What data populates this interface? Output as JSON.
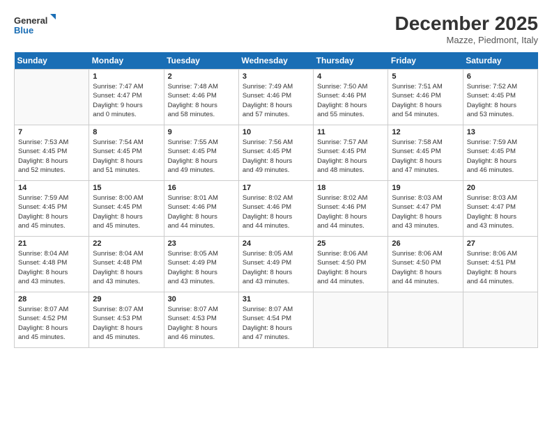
{
  "logo": {
    "line1": "General",
    "line2": "Blue"
  },
  "header": {
    "month": "December 2025",
    "location": "Mazze, Piedmont, Italy"
  },
  "days_of_week": [
    "Sunday",
    "Monday",
    "Tuesday",
    "Wednesday",
    "Thursday",
    "Friday",
    "Saturday"
  ],
  "weeks": [
    [
      {
        "day": "",
        "info": ""
      },
      {
        "day": "1",
        "info": "Sunrise: 7:47 AM\nSunset: 4:47 PM\nDaylight: 9 hours\nand 0 minutes."
      },
      {
        "day": "2",
        "info": "Sunrise: 7:48 AM\nSunset: 4:46 PM\nDaylight: 8 hours\nand 58 minutes."
      },
      {
        "day": "3",
        "info": "Sunrise: 7:49 AM\nSunset: 4:46 PM\nDaylight: 8 hours\nand 57 minutes."
      },
      {
        "day": "4",
        "info": "Sunrise: 7:50 AM\nSunset: 4:46 PM\nDaylight: 8 hours\nand 55 minutes."
      },
      {
        "day": "5",
        "info": "Sunrise: 7:51 AM\nSunset: 4:46 PM\nDaylight: 8 hours\nand 54 minutes."
      },
      {
        "day": "6",
        "info": "Sunrise: 7:52 AM\nSunset: 4:45 PM\nDaylight: 8 hours\nand 53 minutes."
      }
    ],
    [
      {
        "day": "7",
        "info": "Sunrise: 7:53 AM\nSunset: 4:45 PM\nDaylight: 8 hours\nand 52 minutes."
      },
      {
        "day": "8",
        "info": "Sunrise: 7:54 AM\nSunset: 4:45 PM\nDaylight: 8 hours\nand 51 minutes."
      },
      {
        "day": "9",
        "info": "Sunrise: 7:55 AM\nSunset: 4:45 PM\nDaylight: 8 hours\nand 49 minutes."
      },
      {
        "day": "10",
        "info": "Sunrise: 7:56 AM\nSunset: 4:45 PM\nDaylight: 8 hours\nand 49 minutes."
      },
      {
        "day": "11",
        "info": "Sunrise: 7:57 AM\nSunset: 4:45 PM\nDaylight: 8 hours\nand 48 minutes."
      },
      {
        "day": "12",
        "info": "Sunrise: 7:58 AM\nSunset: 4:45 PM\nDaylight: 8 hours\nand 47 minutes."
      },
      {
        "day": "13",
        "info": "Sunrise: 7:59 AM\nSunset: 4:45 PM\nDaylight: 8 hours\nand 46 minutes."
      }
    ],
    [
      {
        "day": "14",
        "info": "Sunrise: 7:59 AM\nSunset: 4:45 PM\nDaylight: 8 hours\nand 45 minutes."
      },
      {
        "day": "15",
        "info": "Sunrise: 8:00 AM\nSunset: 4:45 PM\nDaylight: 8 hours\nand 45 minutes."
      },
      {
        "day": "16",
        "info": "Sunrise: 8:01 AM\nSunset: 4:46 PM\nDaylight: 8 hours\nand 44 minutes."
      },
      {
        "day": "17",
        "info": "Sunrise: 8:02 AM\nSunset: 4:46 PM\nDaylight: 8 hours\nand 44 minutes."
      },
      {
        "day": "18",
        "info": "Sunrise: 8:02 AM\nSunset: 4:46 PM\nDaylight: 8 hours\nand 44 minutes."
      },
      {
        "day": "19",
        "info": "Sunrise: 8:03 AM\nSunset: 4:47 PM\nDaylight: 8 hours\nand 43 minutes."
      },
      {
        "day": "20",
        "info": "Sunrise: 8:03 AM\nSunset: 4:47 PM\nDaylight: 8 hours\nand 43 minutes."
      }
    ],
    [
      {
        "day": "21",
        "info": "Sunrise: 8:04 AM\nSunset: 4:48 PM\nDaylight: 8 hours\nand 43 minutes."
      },
      {
        "day": "22",
        "info": "Sunrise: 8:04 AM\nSunset: 4:48 PM\nDaylight: 8 hours\nand 43 minutes."
      },
      {
        "day": "23",
        "info": "Sunrise: 8:05 AM\nSunset: 4:49 PM\nDaylight: 8 hours\nand 43 minutes."
      },
      {
        "day": "24",
        "info": "Sunrise: 8:05 AM\nSunset: 4:49 PM\nDaylight: 8 hours\nand 43 minutes."
      },
      {
        "day": "25",
        "info": "Sunrise: 8:06 AM\nSunset: 4:50 PM\nDaylight: 8 hours\nand 44 minutes."
      },
      {
        "day": "26",
        "info": "Sunrise: 8:06 AM\nSunset: 4:50 PM\nDaylight: 8 hours\nand 44 minutes."
      },
      {
        "day": "27",
        "info": "Sunrise: 8:06 AM\nSunset: 4:51 PM\nDaylight: 8 hours\nand 44 minutes."
      }
    ],
    [
      {
        "day": "28",
        "info": "Sunrise: 8:07 AM\nSunset: 4:52 PM\nDaylight: 8 hours\nand 45 minutes."
      },
      {
        "day": "29",
        "info": "Sunrise: 8:07 AM\nSunset: 4:53 PM\nDaylight: 8 hours\nand 45 minutes."
      },
      {
        "day": "30",
        "info": "Sunrise: 8:07 AM\nSunset: 4:53 PM\nDaylight: 8 hours\nand 46 minutes."
      },
      {
        "day": "31",
        "info": "Sunrise: 8:07 AM\nSunset: 4:54 PM\nDaylight: 8 hours\nand 47 minutes."
      },
      {
        "day": "",
        "info": ""
      },
      {
        "day": "",
        "info": ""
      },
      {
        "day": "",
        "info": ""
      }
    ]
  ]
}
